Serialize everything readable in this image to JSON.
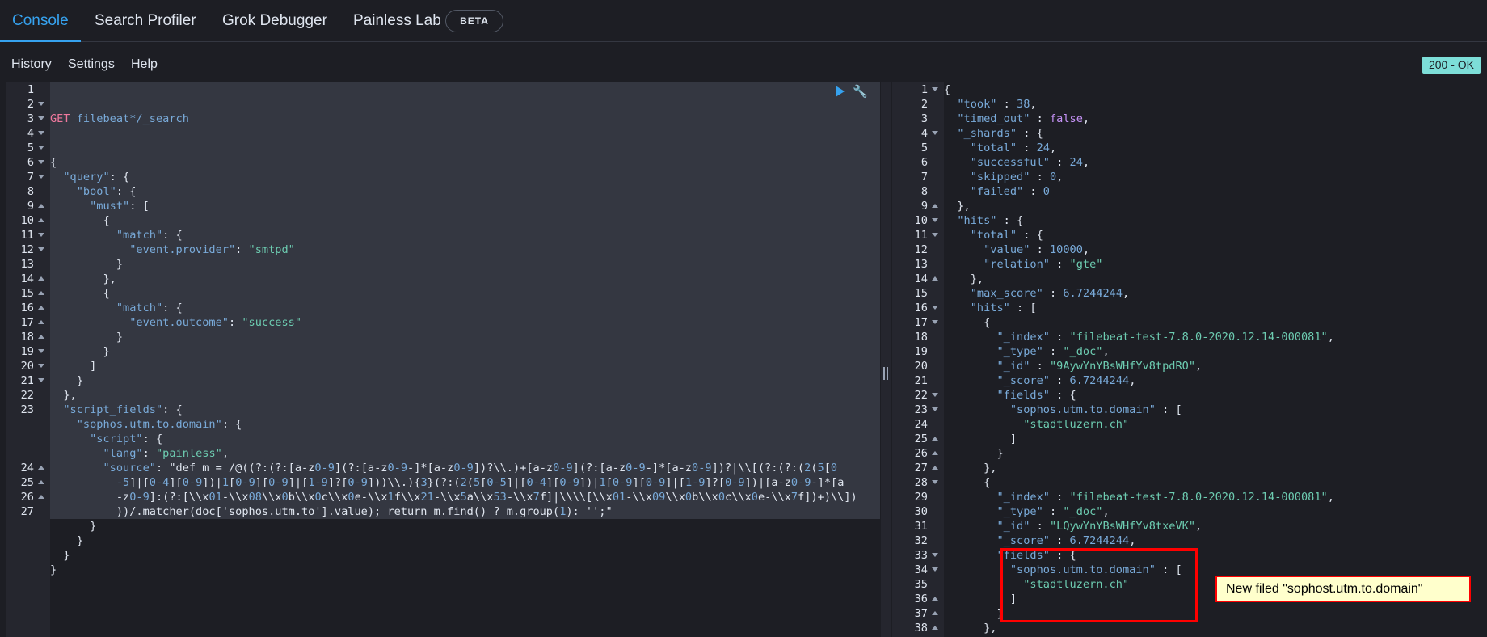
{
  "tabs": [
    {
      "label": "Console",
      "active": true
    },
    {
      "label": "Search Profiler"
    },
    {
      "label": "Grok Debugger"
    },
    {
      "label": "Painless Lab"
    }
  ],
  "beta_badge": "BETA",
  "menu": {
    "history": "History",
    "settings": "Settings",
    "help": "Help"
  },
  "status_badge": "200 - OK",
  "annotation": "New filed \"sophost.utm.to.domain\"",
  "colors": {
    "accent": "#36a2ef",
    "status": "#7dded8",
    "annotation": "#ff0000"
  },
  "request": {
    "method": "GET",
    "url": "filebeat*/_search",
    "line_numbers": [
      "1",
      "2",
      "3",
      "4",
      "5",
      "6",
      "7",
      "8",
      "9",
      "10",
      "11",
      "12",
      "13",
      "14",
      "15",
      "16",
      "17",
      "18",
      "19",
      "20",
      "21",
      "22",
      "23",
      "",
      "",
      "",
      "24",
      "25",
      "26",
      "27"
    ],
    "lines": [
      "{",
      "  \"query\": {",
      "    \"bool\": {",
      "      \"must\": [",
      "        {",
      "          \"match\": {",
      "            \"event.provider\": \"smtpd\"",
      "          }",
      "        },",
      "        {",
      "          \"match\": {",
      "            \"event.outcome\": \"success\"",
      "          }",
      "        }",
      "      ]",
      "    }",
      "  },",
      "  \"script_fields\": {",
      "    \"sophos.utm.to.domain\": {",
      "      \"script\": {",
      "        \"lang\": \"painless\",",
      "        \"source\": \"def m = /@((?:(?:[a-z0-9](?:[a-z0-9-]*[a-z0-9])?\\\\.)+[a-z0-9](?:[a-z0-9-]*[a-z0-9])?|\\\\[(?:(?:(2(5[0",
      "          -5]|[0-4][0-9])|1[0-9][0-9]|[1-9]?[0-9]))\\\\.){3}(?:(2(5[0-5]|[0-4][0-9])|1[0-9][0-9]|[1-9]?[0-9])|[a-z0-9-]*[a",
      "          -z0-9]:(?:[\\\\x01-\\\\x08\\\\x0b\\\\x0c\\\\x0e-\\\\x1f\\\\x21-\\\\x5a\\\\x53-\\\\x7f]|\\\\\\\\[\\\\x01-\\\\x09\\\\x0b\\\\x0c\\\\x0e-\\\\x7f])+)\\\\])",
      "          ))/.matcher(doc['sophos.utm.to'].value); return m.find() ? m.group(1): '';\"",
      "      }",
      "    }",
      "  }",
      "}"
    ]
  },
  "response": {
    "line_numbers": [
      "1",
      "2",
      "3",
      "4",
      "5",
      "6",
      "7",
      "8",
      "9",
      "10",
      "11",
      "12",
      "13",
      "14",
      "15",
      "16",
      "17",
      "18",
      "19",
      "20",
      "21",
      "22",
      "23",
      "24",
      "25",
      "26",
      "27",
      "28",
      "29",
      "30",
      "31",
      "32",
      "33",
      "34",
      "35",
      "36",
      "37",
      "38"
    ],
    "lines": [
      "{",
      "  \"took\" : 38,",
      "  \"timed_out\" : false,",
      "  \"_shards\" : {",
      "    \"total\" : 24,",
      "    \"successful\" : 24,",
      "    \"skipped\" : 0,",
      "    \"failed\" : 0",
      "  },",
      "  \"hits\" : {",
      "    \"total\" : {",
      "      \"value\" : 10000,",
      "      \"relation\" : \"gte\"",
      "    },",
      "    \"max_score\" : 6.7244244,",
      "    \"hits\" : [",
      "      {",
      "        \"_index\" : \"filebeat-test-7.8.0-2020.12.14-000081\",",
      "        \"_type\" : \"_doc\",",
      "        \"_id\" : \"9AywYnYBsWHfYv8tpdRO\",",
      "        \"_score\" : 6.7244244,",
      "        \"fields\" : {",
      "          \"sophos.utm.to.domain\" : [",
      "            \"stadtluzern.ch\"",
      "          ]",
      "        }",
      "      },",
      "      {",
      "        \"_index\" : \"filebeat-test-7.8.0-2020.12.14-000081\",",
      "        \"_type\" : \"_doc\",",
      "        \"_id\" : \"LQywYnYBsWHfYv8txeVK\",",
      "        \"_score\" : 6.7244244,",
      "        \"fields\" : {",
      "          \"sophos.utm.to.domain\" : [",
      "            \"stadtluzern.ch\"",
      "          ]",
      "        }",
      "      },"
    ]
  }
}
